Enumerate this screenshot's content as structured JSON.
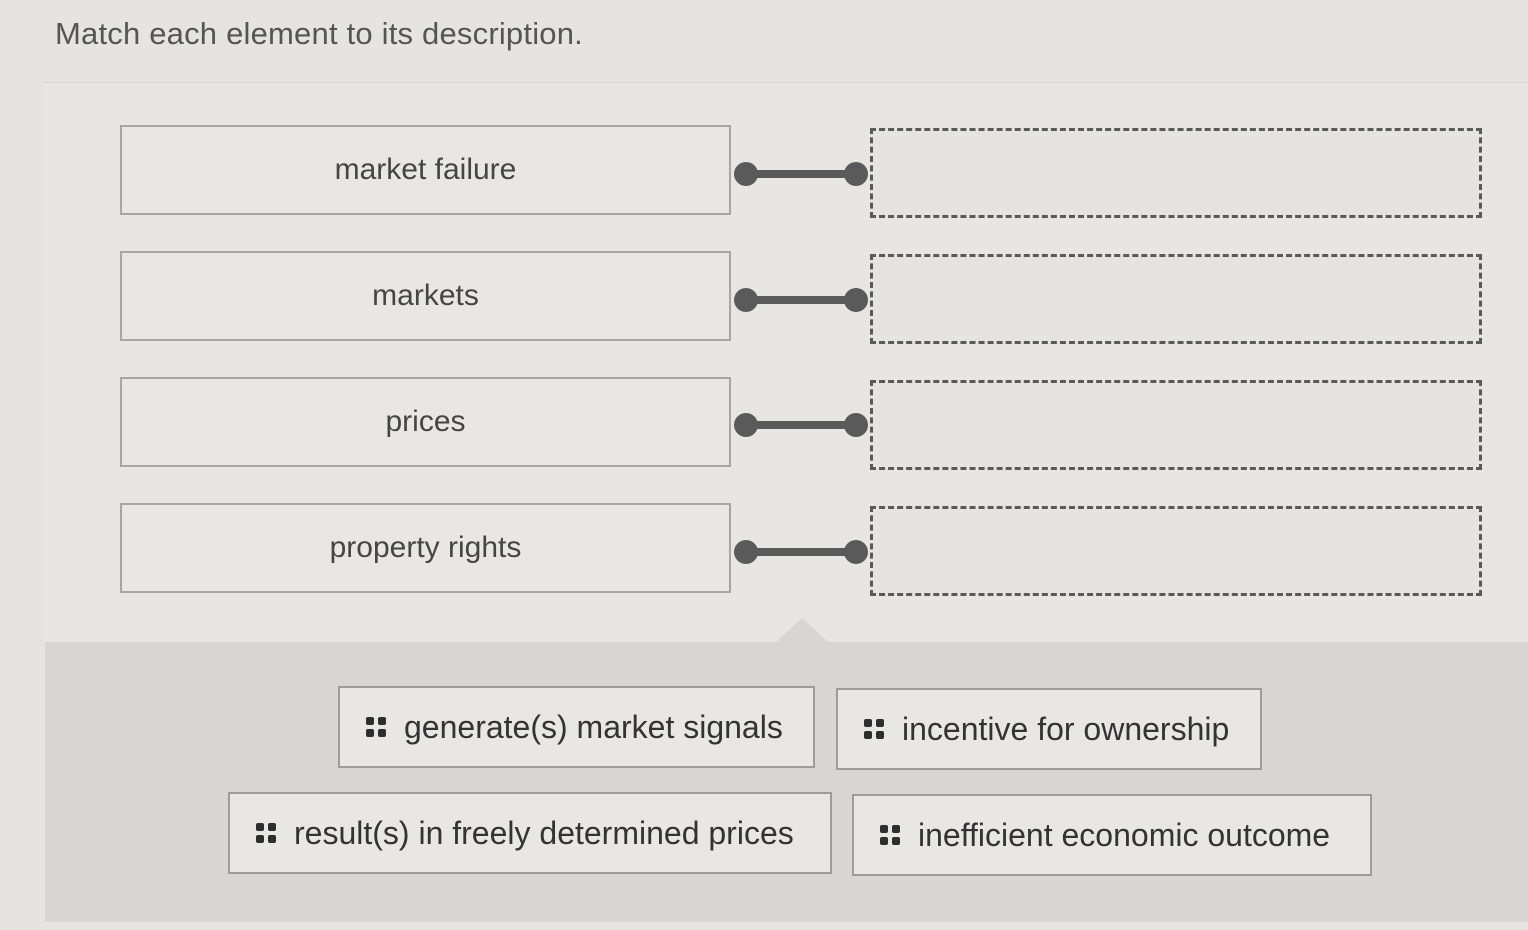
{
  "instructions": "Match each element to its description.",
  "terms": [
    {
      "label": "market failure"
    },
    {
      "label": "markets"
    },
    {
      "label": "prices"
    },
    {
      "label": "property rights"
    }
  ],
  "choices": [
    {
      "label": "generate(s) market signals",
      "icon": "drag-handle-icon"
    },
    {
      "label": "incentive for ownership",
      "icon": "drag-handle-icon"
    },
    {
      "label": "result(s) in freely determined prices",
      "icon": "drag-handle-icon"
    },
    {
      "label": "inefficient economic outcome",
      "icon": "drag-handle-icon"
    }
  ],
  "colors": {
    "background": "#e6e4e1",
    "tray": "#d8d6d3",
    "connector": "#5a5a5a",
    "drop_border": "#595959"
  }
}
